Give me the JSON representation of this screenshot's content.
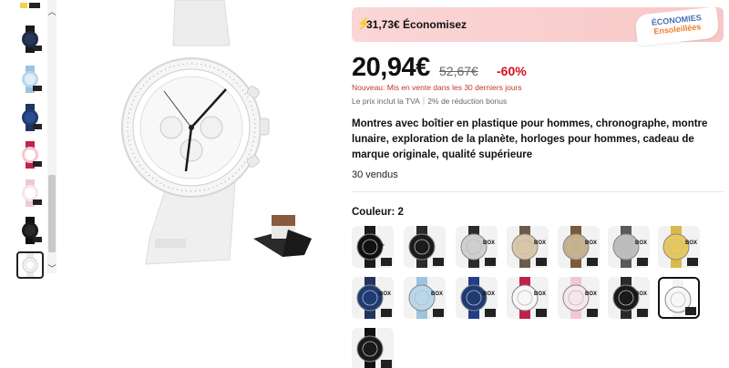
{
  "savings": {
    "text": "31,73€ Économisez"
  },
  "badge": {
    "line1": "ÉCONOMIES",
    "line2": "Ensoleillées"
  },
  "price": {
    "current": "20,94€",
    "old": "52,67€",
    "discount": "-60%"
  },
  "notes": {
    "new": "Nouveau: Mis en vente dans les 30 derniers jours",
    "tva": "Le prix inclut la TVA｜2% de réduction bonus"
  },
  "product": {
    "title": "Montres avec boîtier en plastique pour hommes, chronographe, montre lunaire, exploration de la planète, horloges pour hommes, cadeau de marque originale, qualité supérieure",
    "sold": "30 vendus"
  },
  "color": {
    "label": "Couleur: 2"
  },
  "colors": {
    "watch_black": "#1a1a1a",
    "watch_blue": "#1f3b73",
    "watch_lightblue": "#b9d7ea",
    "watch_pink": "#f3c7d2",
    "watch_white": "#f7f7f7",
    "accent_red": "#d4111f"
  },
  "swatches": [
    {
      "dial": "#111111",
      "strap": "#1b1b1b",
      "box": false,
      "plus": true
    },
    {
      "dial": "#1b1b1b",
      "strap": "#2a2a2a",
      "box": false,
      "plus": false
    },
    {
      "dial": "#cfcfcf",
      "strap": "#2b2b2b",
      "box": true
    },
    {
      "dial": "#d9c7a7",
      "strap": "#6a5a49",
      "box": true
    },
    {
      "dial": "#c7b08c",
      "strap": "#7a5a3a",
      "box": true
    },
    {
      "dial": "#bdbdbd",
      "strap": "#5a5a5a",
      "box": true
    },
    {
      "dial": "#f3efe6",
      "strap": "#c0392b",
      "box": true
    },
    {
      "dial": "#e8c85a",
      "strap": "#d9b94a",
      "box": true
    },
    {
      "dial": "#1f3b73",
      "strap": "#22345e",
      "box": true
    },
    {
      "dial": "#b9d7ea",
      "strap": "#9cc4df",
      "box": true
    },
    {
      "dial": "#1f3b73",
      "strap": "#223f86",
      "box": true
    },
    {
      "dial": "#f7f7f7",
      "strap": "#c2214a",
      "box": true
    },
    {
      "dial": "#f7e7ea",
      "strap": "#f3c7d2",
      "box": true
    },
    {
      "dial": "#1a1a1a",
      "strap": "#2a2a2a",
      "box": true
    },
    {
      "dial": "#f7f7f7",
      "strap": "#f3f3f3",
      "box": false
    },
    {
      "dial": "#1a1a1a",
      "strap": "#111111",
      "box": false
    }
  ],
  "box_label": "BOX",
  "plus_label": "+"
}
